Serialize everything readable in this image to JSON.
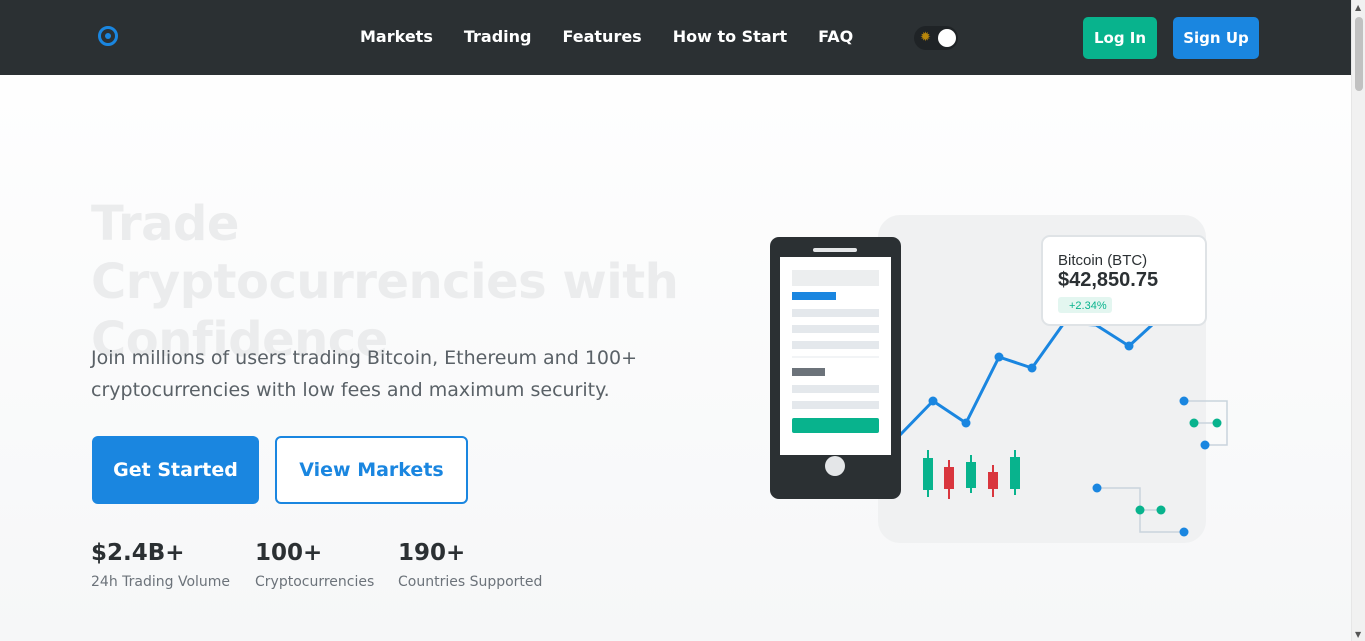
{
  "nav": {
    "links": [
      "Markets",
      "Trading",
      "Features",
      "How to Start",
      "FAQ"
    ],
    "login_label": "Log In",
    "signup_label": "Sign Up",
    "theme_icon": "sun-icon"
  },
  "hero": {
    "title": "Trade Cryptocurrencies with Confidence",
    "subtitle": "Join millions of users trading Bitcoin, Ethereum and 100+ cryptocurrencies with low fees and maximum security.",
    "primary_cta": "Get Started",
    "secondary_cta": "View Markets"
  },
  "stats": [
    {
      "value": "$2.4B+",
      "label": "24h Trading Volume"
    },
    {
      "value": "100+",
      "label": "Cryptocurrencies"
    },
    {
      "value": "190+",
      "label": "Countries Supported"
    }
  ],
  "price_card": {
    "name": "Bitcoin (BTC)",
    "price": "$42,850.75",
    "change": "+2.34%"
  },
  "colors": {
    "nav_bg": "#2b3033",
    "primary": "#1a86e0",
    "success": "#08b38d",
    "danger": "#d9363e"
  }
}
